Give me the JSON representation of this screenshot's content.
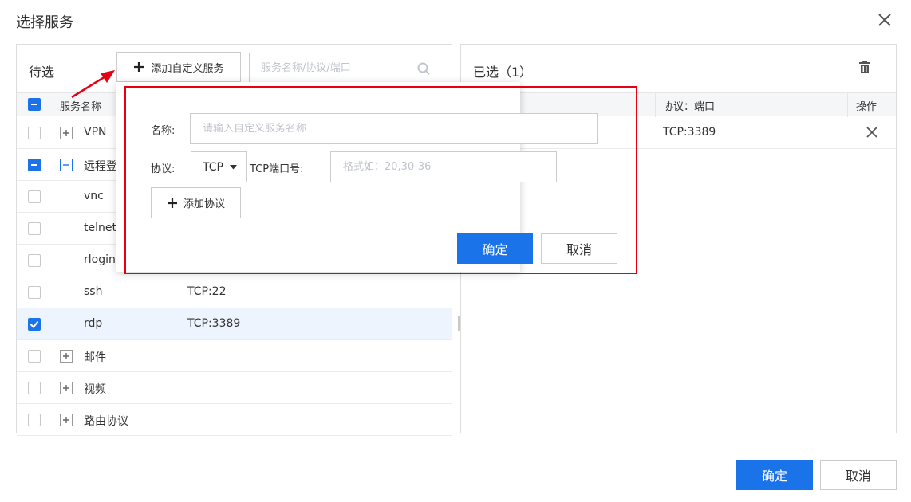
{
  "dialog": {
    "title": "选择服务",
    "close_icon": "close-icon"
  },
  "left_panel": {
    "title": "待选",
    "add_custom_label": "添加自定义服务",
    "search_placeholder": "服务名称/协议/端口",
    "columns": [
      "服务名称"
    ],
    "rows": [
      {
        "name": "VPN",
        "protocol": "",
        "checked": "unchecked",
        "expander": "plus",
        "indent": 0
      },
      {
        "name": "远程登",
        "protocol": "",
        "checked": "partial",
        "expander": "minus",
        "indent": 0
      },
      {
        "name": "vnc",
        "protocol": "",
        "checked": "unchecked",
        "expander": "none",
        "indent": 1
      },
      {
        "name": "telnet",
        "protocol": "",
        "checked": "unchecked",
        "expander": "none",
        "indent": 1
      },
      {
        "name": "rlogin",
        "protocol": "",
        "checked": "unchecked",
        "expander": "none",
        "indent": 1
      },
      {
        "name": "ssh",
        "protocol": "TCP:22",
        "checked": "unchecked",
        "expander": "none",
        "indent": 1
      },
      {
        "name": "rdp",
        "protocol": "TCP:3389",
        "checked": "checked",
        "expander": "none",
        "indent": 1
      },
      {
        "name": "邮件",
        "protocol": "",
        "checked": "unchecked",
        "expander": "plus",
        "indent": 0
      },
      {
        "name": "视频",
        "protocol": "",
        "checked": "unchecked",
        "expander": "plus",
        "indent": 0
      },
      {
        "name": "路由协议",
        "protocol": "",
        "checked": "unchecked",
        "expander": "plus",
        "indent": 0
      }
    ]
  },
  "right_panel": {
    "title": "已选（1）",
    "columns": [
      "协议：端口",
      "操作"
    ],
    "rows": [
      {
        "protocol": "TCP:3389"
      }
    ]
  },
  "popover": {
    "name_label": "名称:",
    "name_placeholder": "请输入自定义服务名称",
    "protocol_label": "协议:",
    "protocol_value": "TCP",
    "port_label": "TCP端口号:",
    "port_placeholder": "格式如：20,30-36",
    "add_protocol_label": "添加协议",
    "confirm_label": "确定",
    "cancel_label": "取消"
  },
  "footer": {
    "confirm_label": "确定",
    "cancel_label": "取消"
  },
  "colors": {
    "primary": "#1a73e8",
    "highlight": "#e60012",
    "arrow": "#e60012"
  }
}
